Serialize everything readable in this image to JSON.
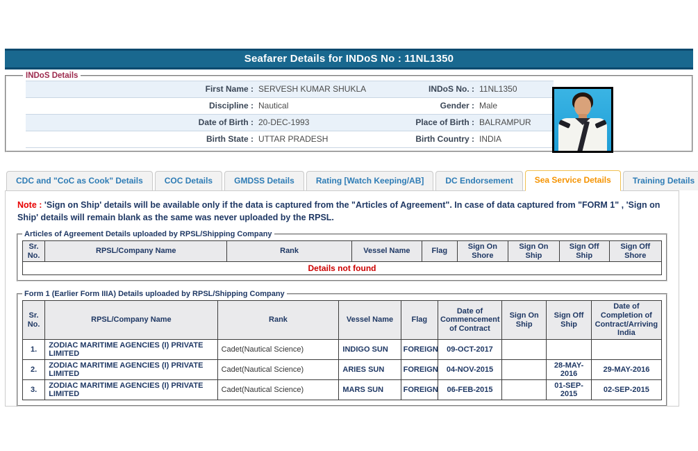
{
  "title": "Seafarer Details for INDoS No : 11NL1350",
  "colors": {
    "header_bar": "#19688f",
    "active_tab_text": "#f59300",
    "active_tab_border": "#f0c050",
    "inactive_tab_text": "#2e7cb5",
    "note_red": "#e80000",
    "error_red": "#cc0000",
    "navy_text": "#1f3864",
    "indos_legend": "#9c2a4d",
    "row_stripe": "#e9f1f9"
  },
  "indos": {
    "legend": "INDoS Details",
    "fields": [
      {
        "l1": "First Name :",
        "v1": "SERVESH KUMAR SHUKLA",
        "l2": "INDoS No. :",
        "v2": "11NL1350"
      },
      {
        "l1": "Discipline :",
        "v1": "Nautical",
        "l2": "Gender :",
        "v2": "Male"
      },
      {
        "l1": "Date of Birth :",
        "v1": "20-DEC-1993",
        "l2": "Place of Birth :",
        "v2": "BALRAMPUR"
      },
      {
        "l1": "Birth State :",
        "v1": "UTTAR PRADESH",
        "l2": "Birth Country :",
        "v2": "INDIA"
      }
    ],
    "photo": "seafarer-photo"
  },
  "tabs": [
    {
      "id": "cdc-coc-as-cook",
      "label": "CDC and \"CoC as Cook\" Details",
      "active": false
    },
    {
      "id": "coc",
      "label": "COC Details",
      "active": false
    },
    {
      "id": "gmdss",
      "label": "GMDSS Details",
      "active": false
    },
    {
      "id": "rating",
      "label": "Rating [Watch Keeping/AB]",
      "active": false
    },
    {
      "id": "dc-endorsement",
      "label": "DC Endorsement",
      "active": false
    },
    {
      "id": "sea-service",
      "label": "Sea Service Details",
      "active": true
    },
    {
      "id": "training",
      "label": "Training Details",
      "active": false
    }
  ],
  "note": {
    "prefix": "Note :",
    "text": "'Sign on Ship' details will be available only if the data is captured from the \"Articles of Agreement\". In case of data captured from \"FORM 1\" , 'Sign on Ship' details will remain blank as the same was never uploaded by the RPSL."
  },
  "articles_table": {
    "legend": "Articles of Agreement Details uploaded by RPSL/Shipping Company",
    "headers": [
      "Sr. No.",
      "RPSL/Company Name",
      "Rank",
      "Vessel Name",
      "Flag",
      "Sign On Shore",
      "Sign On Ship",
      "Sign Off Ship",
      "Sign Off Shore"
    ],
    "empty_text": "Details not found"
  },
  "form1_table": {
    "legend": "Form 1 (Earlier Form IIIA) Details uploaded by RPSL/Shipping Company",
    "headers": [
      "Sr. No.",
      "RPSL/Company Name",
      "Rank",
      "Vessel Name",
      "Flag",
      "Date of Commencement of Contract",
      "Sign On Ship",
      "Sign Off Ship",
      "Date of Completion of Contract/Arriving India"
    ],
    "rows": [
      {
        "sr": "1.",
        "company": "ZODIAC MARITIME AGENCIES (I) PRIVATE LIMITED",
        "rank": "Cadet(Nautical Science)",
        "vessel": "INDIGO SUN",
        "flag": "FOREIGN",
        "commencement": "09-OCT-2017",
        "sign_on_ship": "",
        "sign_off_ship": "",
        "completion": ""
      },
      {
        "sr": "2.",
        "company": "ZODIAC MARITIME AGENCIES (I) PRIVATE LIMITED",
        "rank": "Cadet(Nautical Science)",
        "vessel": "ARIES SUN",
        "flag": "FOREIGN",
        "commencement": "04-NOV-2015",
        "sign_on_ship": "",
        "sign_off_ship": "28-MAY-2016",
        "completion": "29-MAY-2016"
      },
      {
        "sr": "3.",
        "company": "ZODIAC MARITIME AGENCIES (I) PRIVATE LIMITED",
        "rank": "Cadet(Nautical Science)",
        "vessel": "MARS SUN",
        "flag": "FOREIGN",
        "commencement": "06-FEB-2015",
        "sign_on_ship": "",
        "sign_off_ship": "01-SEP-2015",
        "completion": "02-SEP-2015"
      }
    ]
  }
}
